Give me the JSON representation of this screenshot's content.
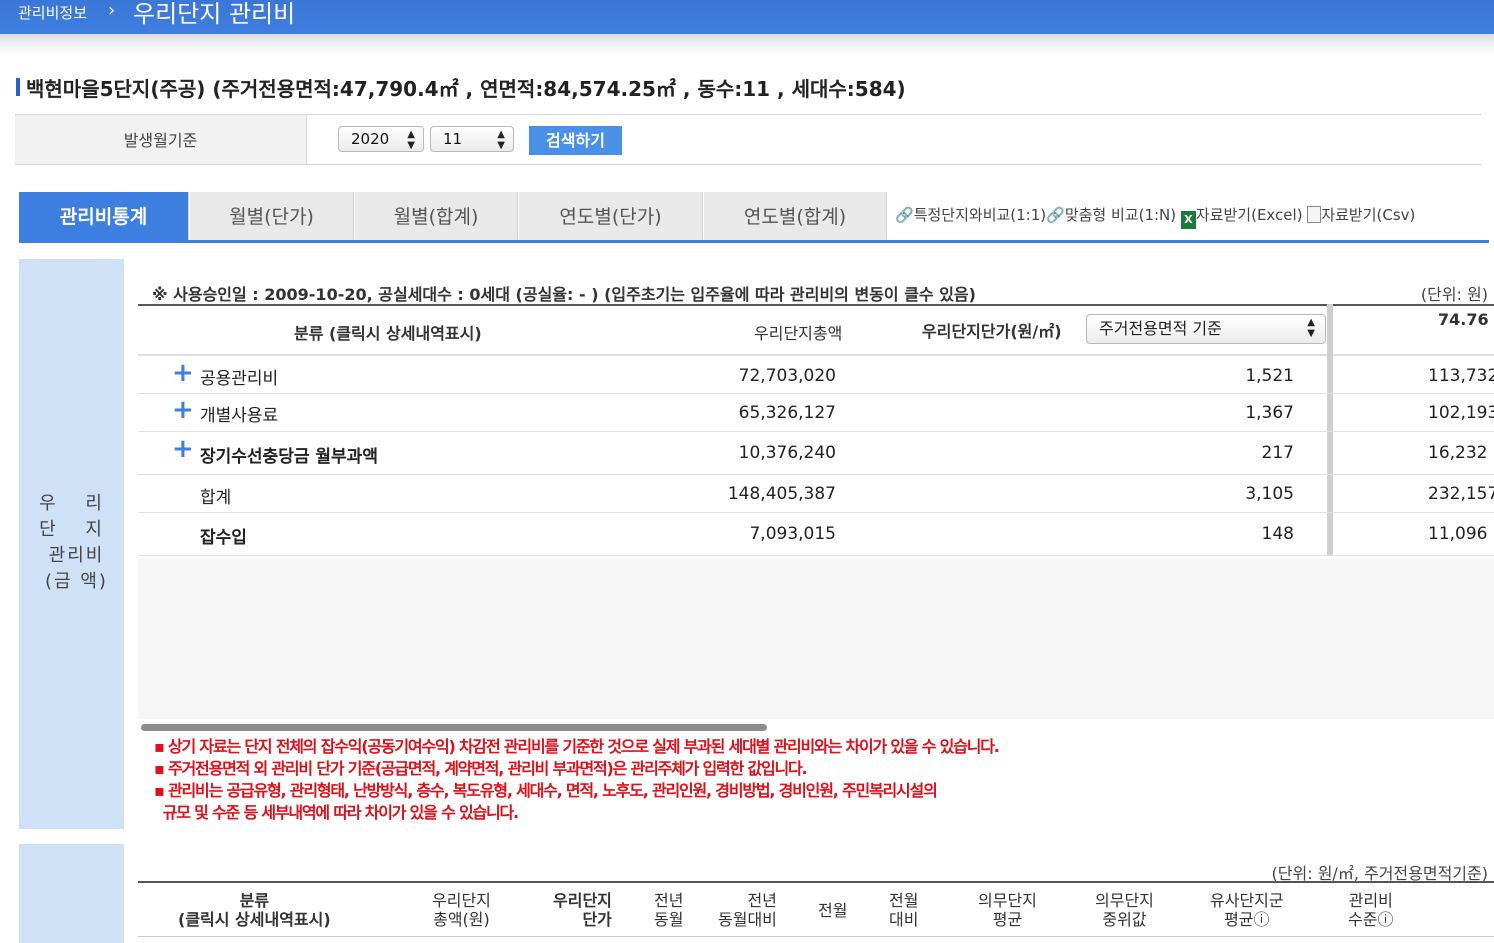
{
  "header": {
    "breadcrumb": "관리비정보",
    "separator": "›",
    "title": "우리단지 관리비"
  },
  "complex_info": "백현마을5단지(주공) (주거전용면적:47,790.4㎡ , 연면적:84,574.25㎡ , 동수:11 , 세대수:584)",
  "search": {
    "label": "발생월기준",
    "year": "2020",
    "month": "11",
    "button": "검색하기"
  },
  "tabs": [
    "관리비통계",
    "월별(단가)",
    "월별(합계)",
    "연도별(단가)",
    "연도별(합계)"
  ],
  "actions": {
    "compare_1_1": "특정단지와비교(1:1)",
    "compare_1_n": "맞춤형 비교(1:N)",
    "excel": "자료받기(Excel)",
    "csv": "자료받기(Csv)"
  },
  "section1": {
    "side_label": [
      "우 리",
      "단 지",
      "관리비",
      "(금 액)"
    ],
    "note": "※ 사용승인일 : 2009-10-20, 공실세대수 : 0세대 (공실율: - ) (입주초기는 입주율에 따라 관리비의 변동이 클수 있음)",
    "unit": "(단위: 원)",
    "headers": {
      "category": "분류 (클릭시 상세내역표시)",
      "total": "우리단지총액",
      "unit_price": "우리단지단가(원/㎡)",
      "basis_select": "주거전용면적 기준",
      "ref_value": "74.76"
    },
    "rows": [
      {
        "plus": "+",
        "category": "공용관리비",
        "total": "72,703,020",
        "unit": "1,521",
        "ref": "113,732"
      },
      {
        "plus": "+",
        "category": "개별사용료",
        "total": "65,326,127",
        "unit": "1,367",
        "ref": "102,193"
      },
      {
        "plus": "+",
        "category": "장기수선충당금 월부과액",
        "total": "10,376,240",
        "unit": "217",
        "ref": "16,232"
      },
      {
        "plus": "",
        "category": "합계",
        "total": "148,405,387",
        "unit": "3,105",
        "ref": "232,157"
      },
      {
        "plus": "",
        "category": "잡수입",
        "total": "7,093,015",
        "unit": "148",
        "ref": "11,096"
      }
    ],
    "warnings": [
      "▪ 상기 자료는 단지 전체의 잡수익(공동기여수익) 차감전 관리비를 기준한 것으로 실제 부과된 세대별 관리비와는 차이가 있을 수 있습니다.",
      "▪ 주거전용면적 외 관리비 단가 기준(공급면적, 계약면적, 관리비 부과면적)은 관리주체가 입력한 값입니다.",
      "▪ 관리비는 공급유형, 관리형태, 난방방식, 층수, 복도유형, 세대수, 면적, 노후도, 관리인원, 경비방법, 경비인원, 주민복리시설의",
      "  규모 및 수준 등 세부내역에 따라 차이가 있을 수 있습니다."
    ]
  },
  "section2": {
    "unit": "(단위: 원/㎡, 주거전용면적기준)",
    "headers": [
      [
        "분류",
        "(클릭시 상세내역표시)"
      ],
      [
        "우리단지",
        "총액(원)"
      ],
      [
        "우리단지",
        "단가"
      ],
      [
        "전년",
        "동월"
      ],
      [
        "전년",
        "동월대비"
      ],
      [
        "전월",
        ""
      ],
      [
        "전월",
        "대비"
      ],
      [
        "의무단지",
        "평균"
      ],
      [
        "의무단지",
        "중위값"
      ],
      [
        "유사단지군",
        "평균ⓘ"
      ],
      [
        "관리비",
        "수준ⓘ"
      ]
    ]
  }
}
